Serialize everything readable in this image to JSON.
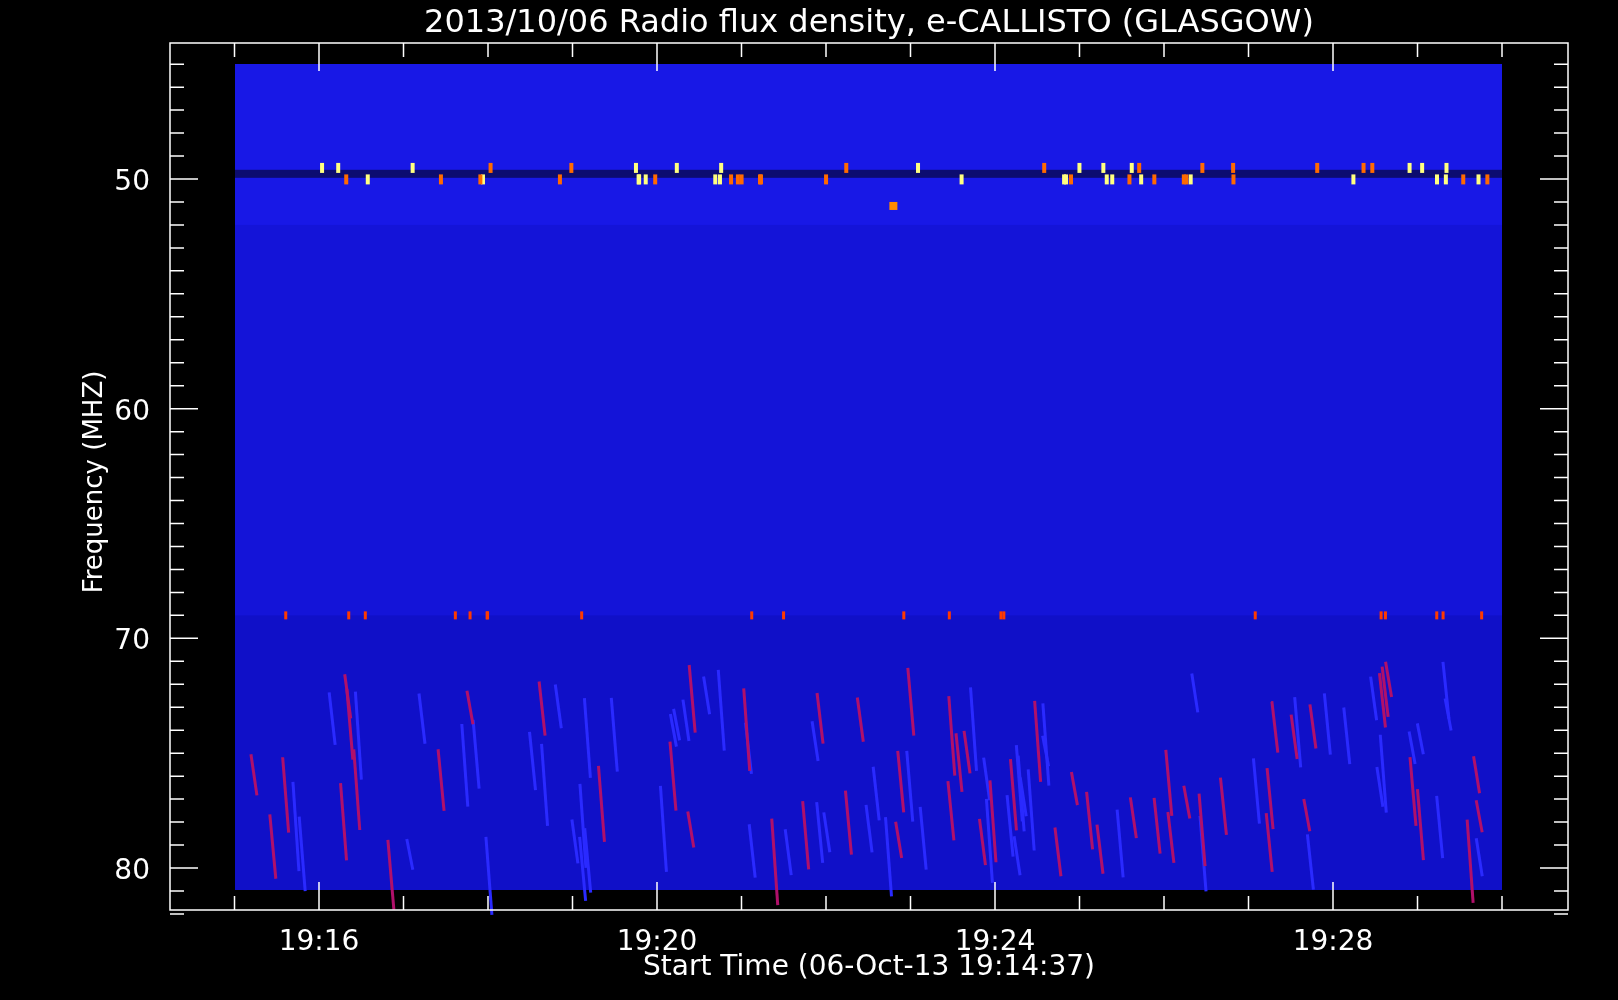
{
  "plot": {
    "title": "2013/10/06  Radio flux density, e-CALLISTO (GLASGOW)",
    "x_axis": {
      "label": "Start Time (06-Oct-13 19:14:37)",
      "ticks": [
        "19:16",
        "19:20",
        "19:24",
        "19:28"
      ]
    },
    "y_axis": {
      "label": "Frequency (MHZ)",
      "ticks": [
        "50",
        "60",
        "70",
        "80"
      ]
    }
  }
}
